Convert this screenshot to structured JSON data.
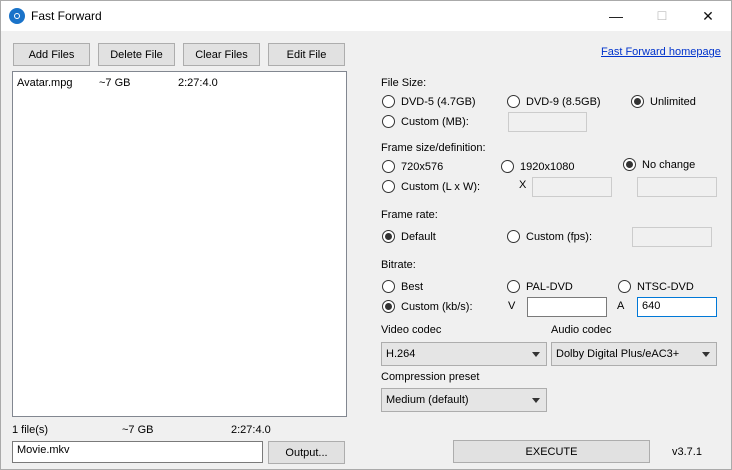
{
  "window": {
    "title": "Fast Forward",
    "minimize": "—",
    "maximize": "☐",
    "close": "✕"
  },
  "toolbar": {
    "add_files": "Add Files",
    "delete_file": "Delete File",
    "clear_files": "Clear Files",
    "edit_file": "Edit File"
  },
  "files": [
    {
      "name": "Avatar.mpg",
      "size": "~7 GB",
      "duration": "2:27:4.0"
    }
  ],
  "summary": {
    "count": "1 file(s)",
    "size": "~7 GB",
    "duration": "2:27:4.0"
  },
  "output": {
    "filename": "Movie.mkv",
    "button": "Output..."
  },
  "homepage_link": "Fast Forward homepage",
  "file_size": {
    "label": "File Size:",
    "dvd5": "DVD-5 (4.7GB)",
    "dvd9": "DVD-9 (8.5GB)",
    "unlimited": "Unlimited",
    "custom": "Custom (MB):",
    "selected": "Unlimited"
  },
  "frame_size": {
    "label": "Frame size/definition:",
    "opt1": "720x576",
    "opt2": "1920x1080",
    "no_change": "No change",
    "custom": "Custom (L x W):",
    "x_label": "X",
    "selected": "No change"
  },
  "frame_rate": {
    "label": "Frame rate:",
    "default": "Default",
    "custom": "Custom (fps):",
    "selected": "Default"
  },
  "bitrate": {
    "label": "Bitrate:",
    "best": "Best",
    "pal": "PAL-DVD",
    "ntsc": "NTSC-DVD",
    "custom": "Custom (kb/s):",
    "v_label": "V",
    "a_label": "A",
    "video_value": "",
    "audio_value": "640",
    "selected": "Custom (kb/s):"
  },
  "video_codec": {
    "label": "Video codec",
    "value": "H.264"
  },
  "audio_codec": {
    "label": "Audio codec",
    "value": "Dolby Digital Plus/eAC3+"
  },
  "compression": {
    "label": "Compression preset",
    "value": "Medium (default)"
  },
  "execute": "EXECUTE",
  "version": "v3.7.1"
}
